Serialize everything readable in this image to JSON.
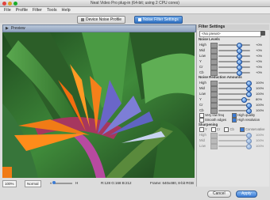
{
  "window": {
    "title": "Neat Video Pro plug-in (64-bit; using 2 CPU cores)"
  },
  "menu": [
    "File",
    "Profile",
    "Filter",
    "Tools",
    "Help"
  ],
  "tabs": [
    {
      "label": "Device Noise Profile",
      "active": false
    },
    {
      "label": "Noise Filter Settings",
      "active": true
    }
  ],
  "preview": {
    "label": "Preview"
  },
  "status": {
    "zoom": "100%",
    "mode": "Normal",
    "slider_left": "0",
    "slider_right": "H",
    "pixel": "R:128 G:168 B:212",
    "frame": "Frame: 640x480, 8-bit RGB"
  },
  "filter_settings": {
    "title": "Filter Settings",
    "preset": "<No preset>",
    "noise_levels": {
      "title": "Noise Levels",
      "rows": [
        {
          "label": "High",
          "value": "+0%",
          "pos": 0.62
        },
        {
          "label": "Mid",
          "value": "+0%",
          "pos": 0.62
        },
        {
          "label": "Low",
          "value": "+0%",
          "pos": 0.62
        },
        {
          "label": "Y",
          "value": "+0%",
          "pos": 0.62
        },
        {
          "label": "Cr",
          "value": "+0%",
          "pos": 0.62
        },
        {
          "label": "Cb",
          "value": "+0%",
          "pos": 0.62
        }
      ]
    },
    "noise_reduction": {
      "title": "Noise Reduction Amounts",
      "rows": [
        {
          "label": "High",
          "value": "100%",
          "pos": 0.95
        },
        {
          "label": "Mid",
          "value": "100%",
          "pos": 0.95
        },
        {
          "label": "Low",
          "value": "100%",
          "pos": 0.95
        },
        {
          "label": "Y",
          "value": "80%",
          "pos": 0.78
        },
        {
          "label": "Cr",
          "value": "100%",
          "pos": 0.95
        },
        {
          "label": "Cb",
          "value": "100%",
          "pos": 0.95
        }
      ]
    },
    "options": [
      {
        "label": "Very low freq",
        "checked": false
      },
      {
        "label": "High quality",
        "checked": true
      },
      {
        "label": "Smooth edges",
        "checked": false
      },
      {
        "label": "High resolution",
        "checked": true
      }
    ],
    "sharpening": {
      "title": "Sharpening",
      "channels": [
        "Y",
        "Cr",
        "Cb"
      ],
      "conservative": "Conservative",
      "rows": [
        {
          "label": "High",
          "value": "100%",
          "pos": 0.95
        },
        {
          "label": "Mid",
          "value": "100%",
          "pos": 0.95
        },
        {
          "label": "Low",
          "value": "100%",
          "pos": 0.95
        }
      ]
    }
  },
  "buttons": {
    "cancel": "Cancel",
    "apply": "Apply"
  },
  "colors": {
    "accent": "#3a7bd5",
    "knob": "#2d6fd1"
  }
}
